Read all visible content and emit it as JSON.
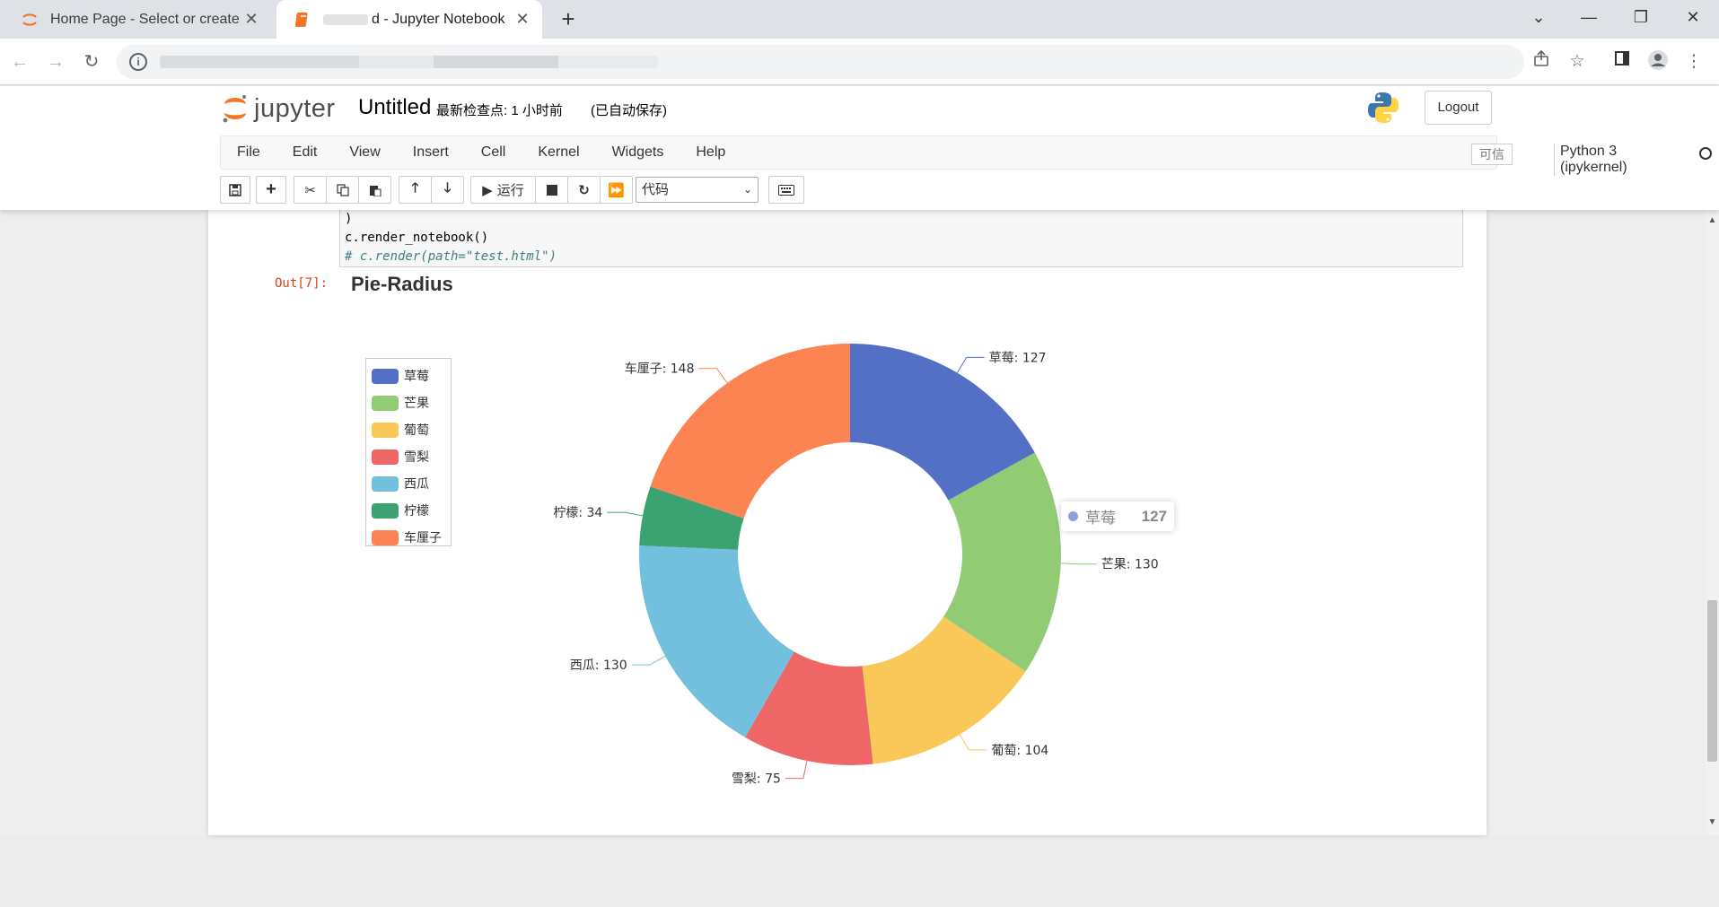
{
  "browser": {
    "tabs": [
      {
        "title": "Home Page - Select or create",
        "active": false
      },
      {
        "title": "d - Jupyter Notebook",
        "active": true
      }
    ],
    "new_tab": "+",
    "window_controls": [
      "⌄",
      "—",
      "❐",
      "✕"
    ]
  },
  "jupyter": {
    "logo_text": "jupyter",
    "notebook_name": "Untitled",
    "checkpoint": "最新检查点: 1 小时前",
    "autosave": "(已自动保存)",
    "logout": "Logout",
    "menus": [
      "File",
      "Edit",
      "View",
      "Insert",
      "Cell",
      "Kernel",
      "Widgets",
      "Help"
    ],
    "trusted": "可信",
    "kernel": "Python 3 (ipykernel)",
    "run_label": "运行",
    "cell_type": "代码"
  },
  "cell": {
    "code_lines": [
      ")",
      "c.render_notebook()"
    ],
    "comment_line": "# c.render(path=\"test.html\")",
    "out_prompt": "Out[7]:"
  },
  "chart_data": {
    "type": "pie",
    "title": "Pie-Radius",
    "variant": "donut",
    "categories": [
      "草莓",
      "芒果",
      "葡萄",
      "雪梨",
      "西瓜",
      "柠檬",
      "车厘子"
    ],
    "values": [
      127,
      130,
      104,
      75,
      130,
      34,
      148
    ],
    "colors": [
      "#5470c6",
      "#91cc75",
      "#fac858",
      "#ee6666",
      "#73c0de",
      "#3ba272",
      "#fc8452"
    ],
    "legend_position": "left",
    "tooltip": {
      "name": "草莓",
      "value": "127"
    }
  }
}
